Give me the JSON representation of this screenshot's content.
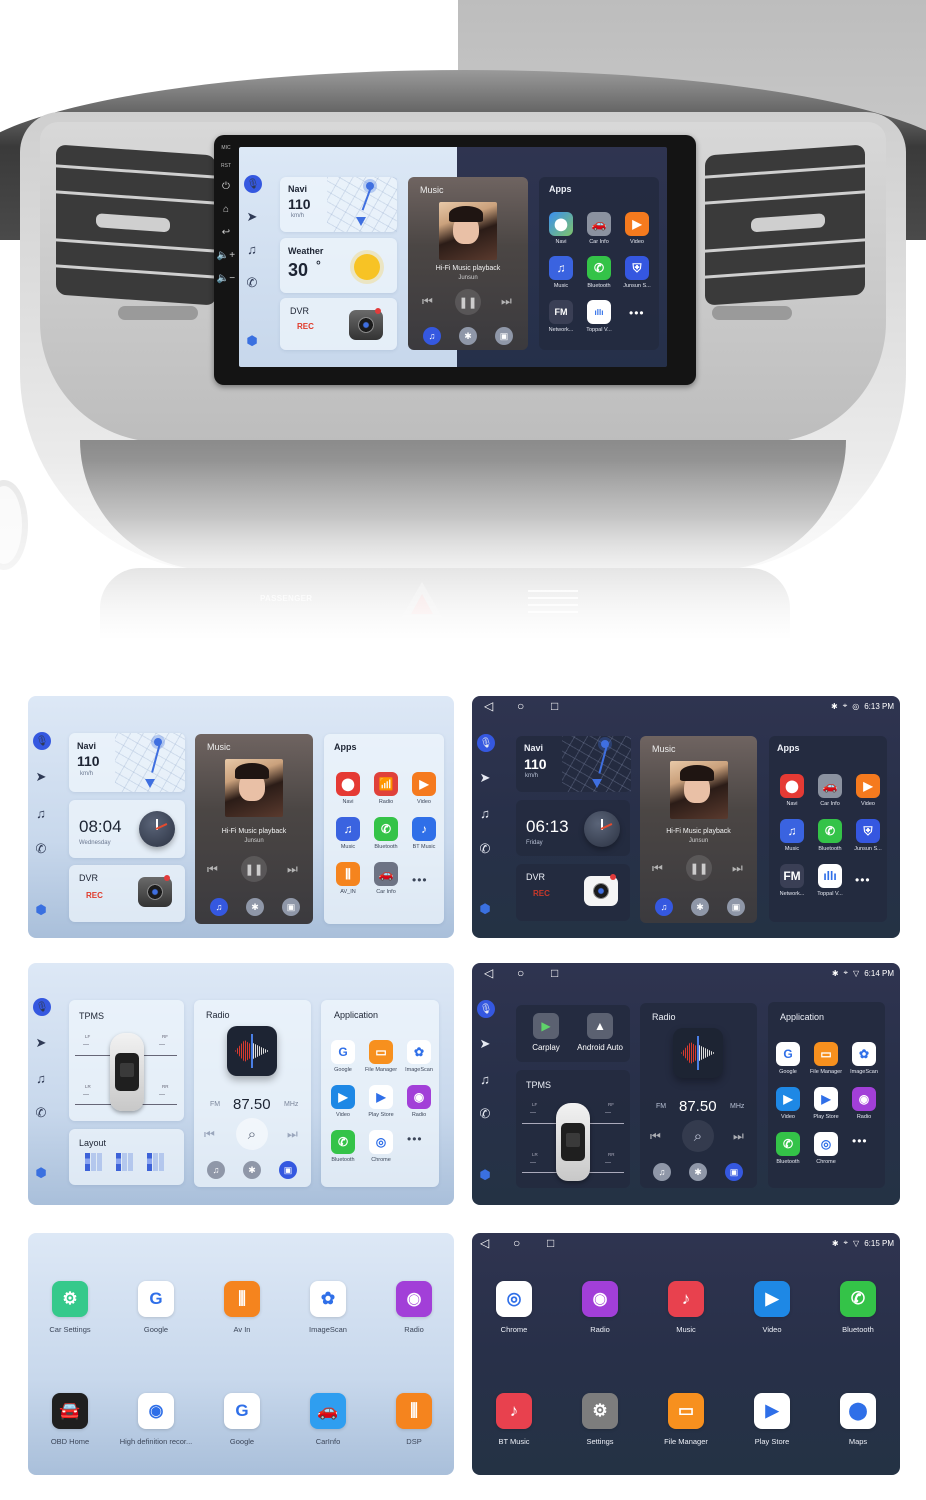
{
  "hero": {
    "console_label": "PASSENGER",
    "unit_side_labels": [
      "MIC",
      "RST"
    ],
    "unit_side_buttons": [
      "power-icon",
      "home-icon",
      "back-icon",
      "volume-up-icon",
      "volume-down-icon"
    ],
    "screen": {
      "navi": {
        "title": "Navi",
        "speed": "110",
        "unit": "km/h"
      },
      "weather": {
        "title": "Weather",
        "temp": "30",
        "deg": "°"
      },
      "dvr": {
        "title": "DVR",
        "status": "REC"
      },
      "music": {
        "title": "Music",
        "song": "Hi-Fi Music playback",
        "artist": "Junsun"
      },
      "apps": {
        "title": "Apps",
        "items": [
          {
            "label": "Navi",
            "icon": "map-pin-icon",
            "color": "#e53a34"
          },
          {
            "label": "Car Info",
            "icon": "car-icon",
            "color": "#8b92a0"
          },
          {
            "label": "Video",
            "icon": "play-icon",
            "color": "#f57a1e"
          },
          {
            "label": "Music",
            "icon": "music-note-icon",
            "color": "#3a63e0"
          },
          {
            "label": "Bluetooth",
            "icon": "phone-icon",
            "color": "#34c348"
          },
          {
            "label": "Junsun S...",
            "icon": "steering-shield-icon",
            "color": "#3557e0"
          },
          {
            "label": "Network...",
            "icon": "fm-icon",
            "color": "#3a3f55"
          },
          {
            "label": "Toppal V...",
            "icon": "voice-wave-icon",
            "color": "#ffffff"
          }
        ],
        "more": "•••"
      }
    }
  },
  "screens": [
    {
      "theme": "light",
      "navi": {
        "title": "Navi",
        "speed": "110",
        "unit": "km/h"
      },
      "clock": {
        "time": "08:04",
        "day": "Wednesday"
      },
      "dvr": {
        "title": "DVR",
        "status": "REC"
      },
      "music": {
        "title": "Music",
        "song": "Hi-Fi Music playback",
        "artist": "Junsun"
      },
      "apps": {
        "title": "Apps",
        "items": [
          {
            "label": "Navi",
            "color": "#e53a34",
            "glyph": "⬤"
          },
          {
            "label": "Radio",
            "color": "#e0413a",
            "glyph": "📶"
          },
          {
            "label": "Video",
            "color": "#f57a1e",
            "glyph": "▶"
          },
          {
            "label": "Music",
            "color": "#3a63e0",
            "glyph": "♫"
          },
          {
            "label": "Bluetooth",
            "color": "#34c348",
            "glyph": "✆"
          },
          {
            "label": "BT Music",
            "color": "#2f6fe8",
            "glyph": "♪"
          },
          {
            "label": "AV_IN",
            "color": "#f5841e",
            "glyph": "⫼"
          },
          {
            "label": "Car Info",
            "color": "#6d7384",
            "glyph": "🚗"
          }
        ],
        "more": "•••"
      }
    },
    {
      "theme": "dark",
      "status": {
        "time": "6:13 PM"
      },
      "navi": {
        "title": "Navi",
        "speed": "110",
        "unit": "km/h"
      },
      "clock": {
        "time": "06:13",
        "day": "Friday"
      },
      "dvr": {
        "title": "DVR",
        "status": "REC"
      },
      "music": {
        "title": "Music",
        "song": "Hi-Fi Music playback",
        "artist": "Junsun"
      },
      "apps": {
        "title": "Apps",
        "items": [
          {
            "label": "Navi",
            "color": "#e53a34",
            "glyph": "⬤"
          },
          {
            "label": "Car Info",
            "color": "#8b92a0",
            "glyph": "🚗"
          },
          {
            "label": "Video",
            "color": "#f57a1e",
            "glyph": "▶"
          },
          {
            "label": "Music",
            "color": "#3a63e0",
            "glyph": "♫"
          },
          {
            "label": "Bluetooth",
            "color": "#34c348",
            "glyph": "✆"
          },
          {
            "label": "Junsun S...",
            "color": "#3557e0",
            "glyph": "⛨"
          },
          {
            "label": "Network...",
            "color": "#3a3f55",
            "glyph": "FM"
          },
          {
            "label": "Toppal V...",
            "color": "#ffffff",
            "glyph": "ıllı"
          }
        ],
        "more": "•••"
      }
    },
    {
      "theme": "light",
      "tpms": {
        "title": "TPMS",
        "lf": "LF",
        "rf": "RF",
        "lr": "LR",
        "rr": "RR",
        "value": "---"
      },
      "layout": {
        "title": "Layout"
      },
      "radio": {
        "title": "Radio",
        "band": "FM",
        "freq": "87.50",
        "unit": "MHz"
      },
      "apps": {
        "title": "Application",
        "items": [
          {
            "label": "Google",
            "color": "#ffffff",
            "glyph": "G"
          },
          {
            "label": "File Manager",
            "color": "#f7901e",
            "glyph": "▭"
          },
          {
            "label": "ImageScan",
            "color": "#ffffff",
            "glyph": "✿"
          },
          {
            "label": "Video",
            "color": "#1e88e5",
            "glyph": "▶"
          },
          {
            "label": "Play Store",
            "color": "#ffffff",
            "glyph": "▶"
          },
          {
            "label": "Radio",
            "color": "#a23fd8",
            "glyph": "◉"
          },
          {
            "label": "Bluetooth",
            "color": "#34c348",
            "glyph": "✆"
          },
          {
            "label": "Chrome",
            "color": "#ffffff",
            "glyph": "◎"
          }
        ],
        "more": "•••"
      }
    },
    {
      "theme": "dark",
      "status": {
        "time": "6:14 PM"
      },
      "carplay": {
        "label": "Carplay"
      },
      "androidauto": {
        "label": "Android Auto"
      },
      "tpms": {
        "title": "TPMS",
        "lf": "LF",
        "rf": "RF",
        "lr": "LR",
        "rr": "RR",
        "value": "---"
      },
      "radio": {
        "title": "Radio",
        "band": "FM",
        "freq": "87.50",
        "unit": "MHz"
      },
      "apps": {
        "title": "Application",
        "items": [
          {
            "label": "Google",
            "color": "#ffffff",
            "glyph": "G"
          },
          {
            "label": "File Manager",
            "color": "#f7901e",
            "glyph": "▭"
          },
          {
            "label": "ImageScan",
            "color": "#ffffff",
            "glyph": "✿"
          },
          {
            "label": "Video",
            "color": "#1e88e5",
            "glyph": "▶"
          },
          {
            "label": "Play Store",
            "color": "#ffffff",
            "glyph": "▶"
          },
          {
            "label": "Radio",
            "color": "#a23fd8",
            "glyph": "◉"
          },
          {
            "label": "Bluetooth",
            "color": "#34c348",
            "glyph": "✆"
          },
          {
            "label": "Chrome",
            "color": "#ffffff",
            "glyph": "◎"
          }
        ],
        "more": "•••"
      }
    },
    {
      "theme": "light",
      "grid": [
        {
          "label": "Car Settings",
          "color": "#35c98b",
          "glyph": "⚙"
        },
        {
          "label": "Google",
          "color": "#ffffff",
          "glyph": "G"
        },
        {
          "label": "Av In",
          "color": "#f5841e",
          "glyph": "⫼"
        },
        {
          "label": "ImageScan",
          "color": "#ffffff",
          "glyph": "✿"
        },
        {
          "label": "Radio",
          "color": "#a23fd8",
          "glyph": "◉"
        },
        {
          "label": "OBD Home",
          "color": "#1f1f1f",
          "glyph": "🚘"
        },
        {
          "label": "High definition recor...",
          "color": "#ffffff",
          "glyph": "◉"
        },
        {
          "label": "Google",
          "color": "#ffffff",
          "glyph": "G"
        },
        {
          "label": "CarInfo",
          "color": "#2f9ef0",
          "glyph": "🚗"
        },
        {
          "label": "DSP",
          "color": "#f5841e",
          "glyph": "⫼"
        }
      ]
    },
    {
      "theme": "dark",
      "status": {
        "time": "6:15 PM"
      },
      "grid": [
        {
          "label": "Chrome",
          "color": "#ffffff",
          "glyph": "◎"
        },
        {
          "label": "Radio",
          "color": "#a23fd8",
          "glyph": "◉"
        },
        {
          "label": "Music",
          "color": "#e8414e",
          "glyph": "♪"
        },
        {
          "label": "Video",
          "color": "#1e88e5",
          "glyph": "▶"
        },
        {
          "label": "Bluetooth",
          "color": "#34c348",
          "glyph": "✆"
        },
        {
          "label": "BT Music",
          "color": "#e8414e",
          "glyph": "♪"
        },
        {
          "label": "Settings",
          "color": "#7d7d7d",
          "glyph": "⚙"
        },
        {
          "label": "File Manager",
          "color": "#f7901e",
          "glyph": "▭"
        },
        {
          "label": "Play Store",
          "color": "#ffffff",
          "glyph": "▶"
        },
        {
          "label": "Maps",
          "color": "#ffffff",
          "glyph": "⬤"
        }
      ]
    }
  ],
  "glyphs": {
    "mic": "🎙",
    "send": "➤",
    "note": "♫",
    "phone": "✆",
    "cube": "⬢",
    "prev": "⏮",
    "next": "⏭",
    "pause": "❚❚",
    "search": "⌕",
    "bt": "✱",
    "radio_src": "▣",
    "back": "◁",
    "home": "○",
    "recent": "□",
    "loc": "⌖",
    "wifi": "◎",
    "wifi_empty": "▽"
  }
}
